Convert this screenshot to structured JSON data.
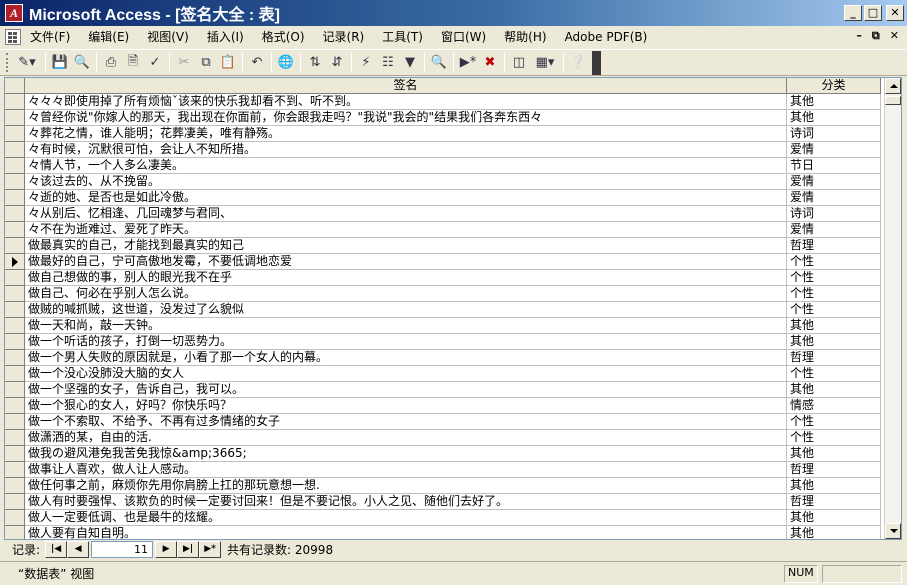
{
  "window": {
    "title": "Microsoft Access - [签名大全 : 表]",
    "app_icon_letter": "A",
    "min_glyph": "_",
    "max_glyph": "□",
    "close_glyph": "✕"
  },
  "menu": {
    "items": [
      "文件(F)",
      "编辑(E)",
      "视图(V)",
      "插入(I)",
      "格式(O)",
      "记录(R)",
      "工具(T)",
      "窗口(W)",
      "帮助(H)",
      "Adobe PDF(B)"
    ],
    "mdi_min": "–",
    "mdi_restore": "⧉",
    "mdi_close": "✕"
  },
  "toolbar": {
    "icons": [
      "design-view-icon",
      "save-icon",
      "search-file-icon",
      "print-icon",
      "print-preview-icon",
      "spelling-icon",
      "cut-icon",
      "copy-icon",
      "paste-icon",
      "undo-icon",
      "hyperlink-icon",
      "sort-ascending-icon",
      "sort-descending-icon",
      "filter-by-selection-icon",
      "filter-by-form-icon",
      "apply-filter-icon",
      "find-icon",
      "new-record-icon",
      "delete-record-icon",
      "properties-icon",
      "database-window-icon",
      "help-icon"
    ]
  },
  "grid": {
    "columns": [
      "签名",
      "分类"
    ],
    "current_row_index": 10,
    "rows": [
      [
        "々々々即使用掉了所有烦恼ˇ该来的快乐我却看不到、听不到。",
        "其他"
      ],
      [
        "々曾经你说\"你嫁人的那天，我出现在你面前，你会跟我走吗？\"我说\"我会的\"结果我们各奔东西々",
        "其他"
      ],
      [
        "々葬花之情，谁人能明；花葬凄美，唯有静殇。",
        "诗词"
      ],
      [
        "々有时候，沉默很可怕，会让人不知所措。",
        "爱情"
      ],
      [
        "々情人节，一个人多么凄美。",
        "节日"
      ],
      [
        "々该过去的、从不挽留。",
        "爱情"
      ],
      [
        "々逝的她、是否也是如此冷傲。",
        "爱情"
      ],
      [
        "々从别后、忆相逢、几回魂梦与君同、",
        "诗词"
      ],
      [
        "々不在为逝难过、爱死了昨天。",
        "爱情"
      ],
      [
        "做最真实的自己，才能找到最真实的知己",
        "哲理"
      ],
      [
        "做最好的自己，宁可高傲地发霉，不要低调地恋爱",
        "个性"
      ],
      [
        "做自己想做的事，别人的眼光我不在乎",
        "个性"
      ],
      [
        "做自己、何必在乎别人怎么说。",
        "个性"
      ],
      [
        "做贼的喊抓贼，这世道，没发过了么貌似",
        "个性"
      ],
      [
        "做一天和尚，敲一天钟。",
        "其他"
      ],
      [
        "做一个听话的孩子，打倒一切恶势力。",
        "其他"
      ],
      [
        "做一个男人失败的原因就是，小看了那一个女人的内幕。",
        "哲理"
      ],
      [
        "做一个没心没肺没大脑的女人",
        "个性"
      ],
      [
        "做一个坚强的女子，告诉自己，我可以。",
        "其他"
      ],
      [
        "做一个狠心的女人，好吗？你快乐吗？",
        "情感"
      ],
      [
        "做一个不索取、不给予、不再有过多情绪的女子",
        "个性"
      ],
      [
        "做潇洒的某，自由的活.",
        "个性"
      ],
      [
        "做我の避风港免我苦免我惊&amp;3665;",
        "其他"
      ],
      [
        "做事让人喜欢，做人让人感动。",
        "哲理"
      ],
      [
        "做任何事之前，麻烦你先用你肩膀上扛的那玩意想一想.",
        "其他"
      ],
      [
        "做人有时要强悍、该欺负的时候一定要讨回来！但是不要记恨。小人之见、随他们去好了。",
        "哲理"
      ],
      [
        "做人一定要低调、也是最牛的炫耀。",
        "其他"
      ],
      [
        "做人要有自知自明。",
        "其他"
      ]
    ]
  },
  "navigation": {
    "label": "记录:",
    "current_record": "11",
    "first": "|◀",
    "prev": "◀",
    "next": "▶",
    "last": "▶|",
    "new": "▶*",
    "total_text": "共有记录数: 20998"
  },
  "status": {
    "view": "“数据表” 视图",
    "num": "NUM"
  }
}
